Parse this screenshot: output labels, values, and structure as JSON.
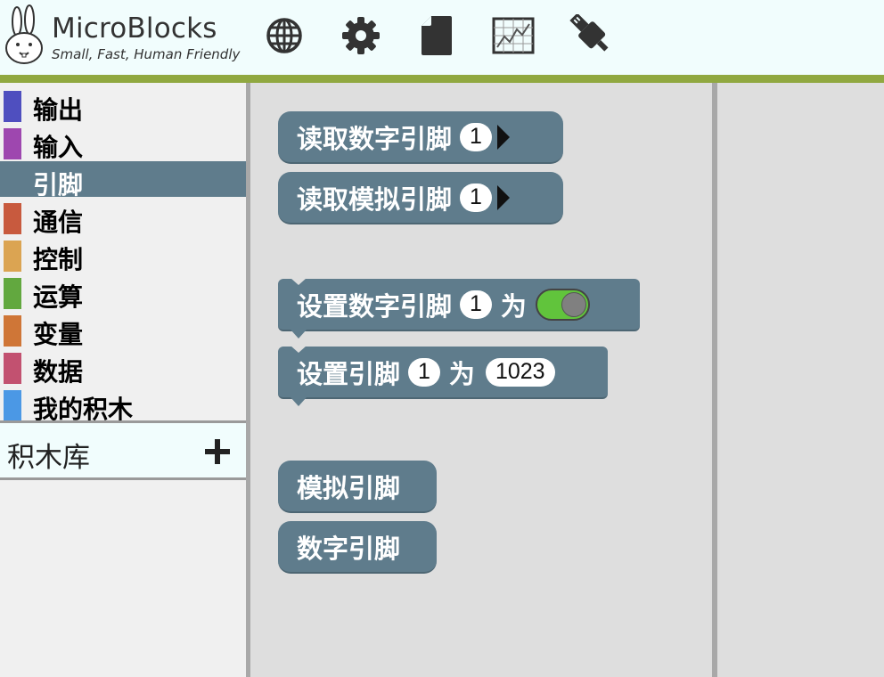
{
  "app": {
    "name": "MicroBlocks",
    "tagline": "Small, Fast, Human Friendly"
  },
  "toolbar": {
    "buttons": [
      {
        "icon": "globe-icon"
      },
      {
        "icon": "gear-icon"
      },
      {
        "icon": "file-icon"
      },
      {
        "icon": "graph-icon"
      },
      {
        "icon": "usb-plug-icon"
      }
    ]
  },
  "sidebar": {
    "categories": [
      {
        "label": "输出",
        "color": "#4f4fbf"
      },
      {
        "label": "输入",
        "color": "#9e47af"
      },
      {
        "label": "引脚",
        "color": "#5f7c8c",
        "selected": true
      },
      {
        "label": "通信",
        "color": "#c85a3e"
      },
      {
        "label": "控制",
        "color": "#dba452"
      },
      {
        "label": "运算",
        "color": "#62a83f"
      },
      {
        "label": "变量",
        "color": "#cf7637"
      },
      {
        "label": "数据",
        "color": "#c25170"
      },
      {
        "label": "我的积木",
        "color": "#4b98e5"
      }
    ],
    "library": {
      "label": "积木库",
      "add_icon": "plus-icon"
    }
  },
  "palette": {
    "block_color": "#5f7c8c",
    "blocks": [
      {
        "label": "读取数字引脚",
        "pin": "1"
      },
      {
        "label": "读取模拟引脚",
        "pin": "1"
      },
      {
        "label": "设置数字引脚",
        "pin": "1",
        "word": "为",
        "toggle_on": true
      },
      {
        "label": "设置引脚",
        "pin": "1",
        "word": "为",
        "value": "1023"
      },
      {
        "label": "模拟引脚"
      },
      {
        "label": "数字引脚"
      }
    ]
  }
}
